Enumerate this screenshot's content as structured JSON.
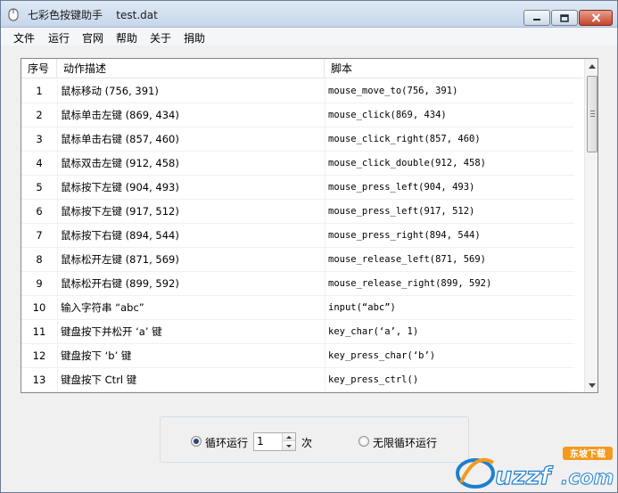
{
  "window": {
    "app_title": "七彩色按键助手",
    "file_name": "test.dat"
  },
  "menu": [
    {
      "label": "文件"
    },
    {
      "label": "运行"
    },
    {
      "label": "官网"
    },
    {
      "label": "帮助"
    },
    {
      "label": "关于"
    },
    {
      "label": "捐助"
    }
  ],
  "table": {
    "columns": [
      "序号",
      "动作描述",
      "脚本"
    ],
    "rows": [
      {
        "no": "1",
        "desc": "鼠标移动 (756, 391)",
        "script": "mouse_move_to(756, 391)"
      },
      {
        "no": "2",
        "desc": "鼠标单击左键 (869, 434)",
        "script": "mouse_click(869, 434)"
      },
      {
        "no": "3",
        "desc": "鼠标单击右键 (857, 460)",
        "script": "mouse_click_right(857, 460)"
      },
      {
        "no": "4",
        "desc": "鼠标双击左键 (912, 458)",
        "script": "mouse_click_double(912, 458)"
      },
      {
        "no": "5",
        "desc": "鼠标按下左键 (904, 493)",
        "script": "mouse_press_left(904, 493)"
      },
      {
        "no": "6",
        "desc": "鼠标按下左键 (917, 512)",
        "script": "mouse_press_left(917, 512)"
      },
      {
        "no": "7",
        "desc": "鼠标按下右键 (894, 544)",
        "script": "mouse_press_right(894, 544)"
      },
      {
        "no": "8",
        "desc": "鼠标松开左键 (871, 569)",
        "script": "mouse_release_left(871, 569)"
      },
      {
        "no": "9",
        "desc": "鼠标松开右键 (899, 592)",
        "script": "mouse_release_right(899, 592)"
      },
      {
        "no": "10",
        "desc": "输入字符串 “abc”",
        "script": "input(“abc”)"
      },
      {
        "no": "11",
        "desc": "键盘按下并松开 ‘a’ 键",
        "script": "key_char(‘a’, 1)"
      },
      {
        "no": "12",
        "desc": "键盘按下 ‘b’ 键",
        "script": "key_press_char(‘b’)"
      },
      {
        "no": "13",
        "desc": "键盘按下 Ctrl 键",
        "script": "key_press_ctrl()"
      }
    ],
    "scroll_position": 0.0
  },
  "loop": {
    "loop_label": "循环运行",
    "loop_selected": true,
    "count_value": "1",
    "count_unit": "次",
    "infinite_label": "无限循环运行",
    "infinite_selected": false
  },
  "watermark": {
    "brand": "uzzf",
    "suffix": ".com",
    "tag": "东坡下载"
  },
  "colors": {
    "titlebar": "#c6d6ea",
    "close_button": "#c7432b",
    "radio_dot": "#29457d",
    "watermark_orange": "#f39a1e",
    "watermark_blue": "#1e7fcf"
  }
}
